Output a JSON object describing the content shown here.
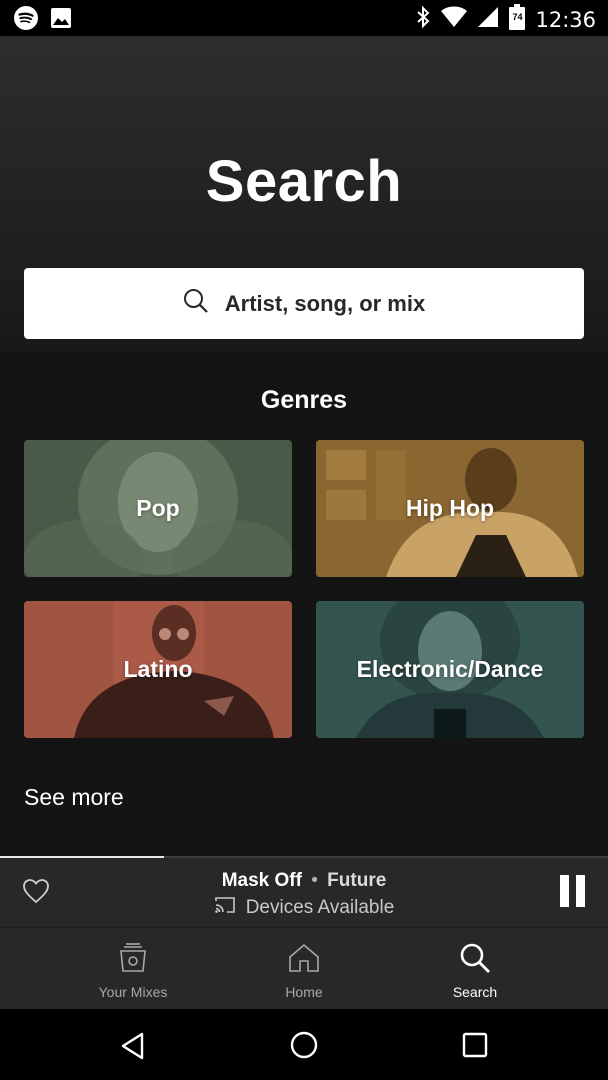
{
  "status_bar": {
    "time": "12:36",
    "battery": "74",
    "left_icons": [
      "spotify-icon",
      "image-icon"
    ],
    "right_icons": [
      "bluetooth-icon",
      "wifi-icon",
      "signal-icon",
      "battery-icon"
    ]
  },
  "header": {
    "title": "Search",
    "search_placeholder": "Artist, song, or mix"
  },
  "genres": {
    "title": "Genres",
    "items": [
      {
        "label": "Pop",
        "color": "#4a5a48"
      },
      {
        "label": "Hip Hop",
        "color": "#9a7434"
      },
      {
        "label": "Latino",
        "color": "#8e4a3a"
      },
      {
        "label": "Electronic/Dance",
        "color": "#3a5a55"
      }
    ],
    "see_more": "See more"
  },
  "now_playing": {
    "song": "Mask Off",
    "separator": "•",
    "artist": "Future",
    "devices": "Devices Available",
    "progress": 0.27
  },
  "bottom_nav": {
    "items": [
      {
        "label": "Your Mixes",
        "icon": "radio-icon",
        "active": false
      },
      {
        "label": "Home",
        "icon": "home-icon",
        "active": false
      },
      {
        "label": "Search",
        "icon": "search-icon",
        "active": true
      }
    ]
  },
  "colors": {
    "background": "#121212",
    "bar": "#282828",
    "accent": "#ffffff"
  }
}
